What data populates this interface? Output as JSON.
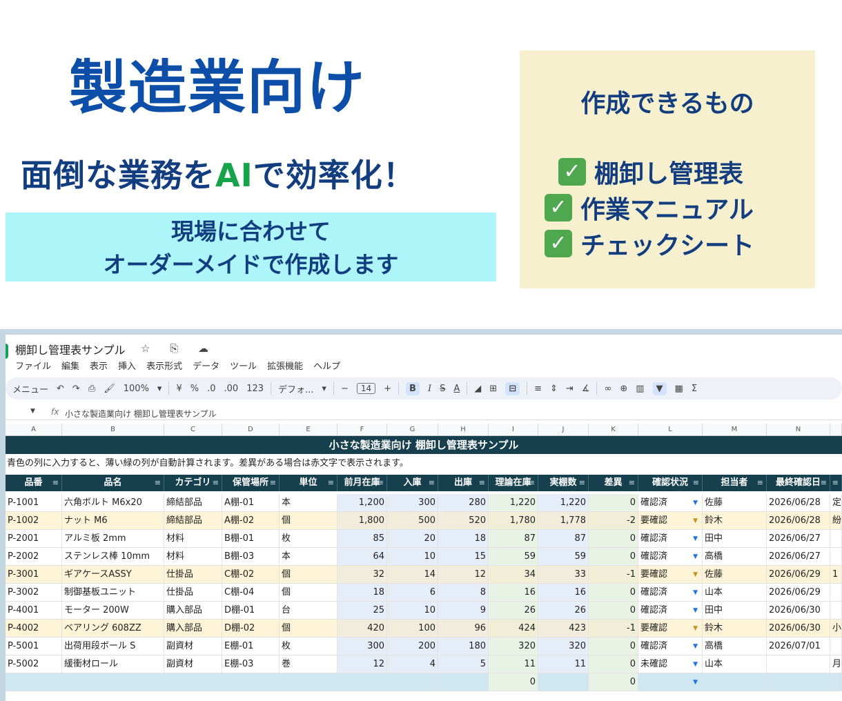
{
  "hero": {
    "title": "製造業向け",
    "subtitle_pre": "面倒な業務を",
    "subtitle_ai": "AI",
    "subtitle_post": "で効率化！",
    "cyan_line1": "現場に合わせて",
    "cyan_line2": "オーダーメイドで作成します"
  },
  "features": {
    "title": "作成できるもの",
    "check_mark": "✓",
    "items": [
      "棚卸し管理表",
      "作業マニュアル",
      "チェックシート"
    ]
  },
  "sheet": {
    "doc_title": "棚卸し管理表サンプル",
    "doc_icons": "☆ ⎘ ☁",
    "menu": [
      "ファイル",
      "編集",
      "表示",
      "挿入",
      "表示形式",
      "データ",
      "ツール",
      "拡張機能",
      "ヘルプ"
    ],
    "toolbar": {
      "menu_search": "メニュー",
      "zoom": "100%",
      "currency": "¥",
      "percent": "%",
      "dec_down": ".0",
      "dec_up": ".00",
      "num_format": "123",
      "font": "デフォ...",
      "font_size": "14",
      "bold": "B",
      "italic": "I",
      "strike": "S",
      "text_color": "A"
    },
    "formula_bar": {
      "fx": "fx",
      "content": "小さな製造業向け 棚卸し管理表サンプル"
    },
    "col_letters": [
      "A",
      "B",
      "C",
      "D",
      "E",
      "F",
      "G",
      "H",
      "I",
      "J",
      "K",
      "L",
      "M",
      "N",
      ""
    ],
    "banner": "小さな製造業向け 棚卸し管理表サンプル",
    "note": "青色の列に入力すると、薄い緑の列が自動計算されます。差異がある場合は赤文字で表示されます。",
    "headers": [
      "品番",
      "品名",
      "カテゴリ",
      "保管場所",
      "単位",
      "前月在庫",
      "入庫",
      "出庫",
      "理論在庫",
      "実棚数",
      "差異",
      "確認状況",
      "担当者",
      "最終確認日",
      ""
    ],
    "rows": [
      {
        "id": "P-1001",
        "name": "六角ボルト M6x20",
        "cat": "締結部品",
        "loc": "A棚-01",
        "unit": "本",
        "prev": "1,200",
        "in": "300",
        "out": "280",
        "theory": "1,220",
        "actual": "1,220",
        "diff": "0",
        "status": "確認済",
        "owner": "佐藤",
        "date": "2026/06/28",
        "extra": "定",
        "type": "ok"
      },
      {
        "id": "P-1002",
        "name": "ナット M6",
        "cat": "締結部品",
        "loc": "A棚-02",
        "unit": "個",
        "prev": "1,800",
        "in": "500",
        "out": "520",
        "theory": "1,780",
        "actual": "1,778",
        "diff": "-2",
        "status": "要確認",
        "owner": "鈴木",
        "date": "2026/06/28",
        "extra": "紛",
        "type": "chk"
      },
      {
        "id": "P-2001",
        "name": "アルミ板 2mm",
        "cat": "材料",
        "loc": "B棚-01",
        "unit": "枚",
        "prev": "85",
        "in": "20",
        "out": "18",
        "theory": "87",
        "actual": "87",
        "diff": "0",
        "status": "確認済",
        "owner": "田中",
        "date": "2026/06/27",
        "extra": "",
        "type": "ok"
      },
      {
        "id": "P-2002",
        "name": "ステンレス棒 10mm",
        "cat": "材料",
        "loc": "B棚-03",
        "unit": "本",
        "prev": "64",
        "in": "10",
        "out": "15",
        "theory": "59",
        "actual": "59",
        "diff": "0",
        "status": "確認済",
        "owner": "高橋",
        "date": "2026/06/27",
        "extra": "",
        "type": "ok"
      },
      {
        "id": "P-3001",
        "name": "ギアケースASSY",
        "cat": "仕掛品",
        "loc": "C棚-02",
        "unit": "個",
        "prev": "32",
        "in": "14",
        "out": "12",
        "theory": "34",
        "actual": "33",
        "diff": "-1",
        "status": "要確認",
        "owner": "佐藤",
        "date": "2026/06/29",
        "extra": "1",
        "type": "chk"
      },
      {
        "id": "P-3002",
        "name": "制御基板ユニット",
        "cat": "仕掛品",
        "loc": "C棚-04",
        "unit": "個",
        "prev": "18",
        "in": "6",
        "out": "8",
        "theory": "16",
        "actual": "16",
        "diff": "0",
        "status": "確認済",
        "owner": "山本",
        "date": "2026/06/29",
        "extra": "",
        "type": "ok"
      },
      {
        "id": "P-4001",
        "name": "モーター 200W",
        "cat": "購入部品",
        "loc": "D棚-01",
        "unit": "台",
        "prev": "25",
        "in": "10",
        "out": "9",
        "theory": "26",
        "actual": "26",
        "diff": "0",
        "status": "確認済",
        "owner": "田中",
        "date": "2026/06/30",
        "extra": "",
        "type": "ok"
      },
      {
        "id": "P-4002",
        "name": "ベアリング 608ZZ",
        "cat": "購入部品",
        "loc": "D棚-02",
        "unit": "個",
        "prev": "420",
        "in": "100",
        "out": "96",
        "theory": "424",
        "actual": "423",
        "diff": "-1",
        "status": "要確認",
        "owner": "鈴木",
        "date": "2026/06/30",
        "extra": "小",
        "type": "chk"
      },
      {
        "id": "P-5001",
        "name": "出荷用段ボール S",
        "cat": "副資材",
        "loc": "E棚-01",
        "unit": "枚",
        "prev": "300",
        "in": "200",
        "out": "180",
        "theory": "320",
        "actual": "320",
        "diff": "0",
        "status": "確認済",
        "owner": "高橋",
        "date": "2026/07/01",
        "extra": "",
        "type": "ok"
      },
      {
        "id": "P-5002",
        "name": "緩衝材ロール",
        "cat": "副資材",
        "loc": "E棚-03",
        "unit": "巻",
        "prev": "12",
        "in": "4",
        "out": "5",
        "theory": "11",
        "actual": "11",
        "diff": "0",
        "status": "未確認",
        "owner": "山本",
        "date": "",
        "extra": "月",
        "type": "ok"
      }
    ],
    "blank_row": {
      "theory": "0",
      "diff": "0"
    }
  }
}
